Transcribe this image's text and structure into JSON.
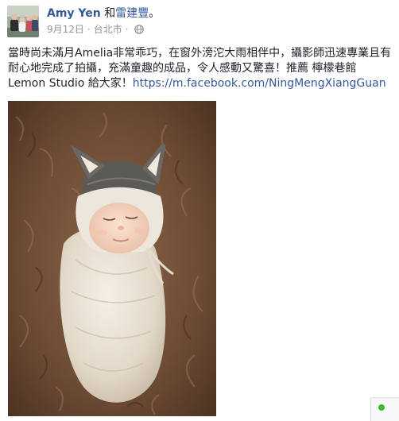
{
  "post": {
    "author": "Amy Yen",
    "with_prefix": "和",
    "with_name": "雷建豐",
    "with_suffix": "。",
    "date": "9月12日",
    "location": "台北市",
    "dot": "·",
    "privacy_icon": "globe-icon",
    "text_part1": "當時尚未滿月Amelia非常乖巧，在窗外滂沱大雨相伴中，攝影師迅速專業且有耐心地完成了拍攝，充滿童趣的成品，令人感動又驚喜！推薦 檸檬巷館 Lemon Studio 給大家！",
    "link": "https://m.facebook.com/NingMengXiangGuan"
  },
  "photo": {
    "icon": "baby-photo"
  },
  "chat": {
    "status_icon": "online-status-icon",
    "status_color": "#42b72a"
  },
  "colors": {
    "link": "#365899",
    "meta": "#90949c",
    "text": "#1d2129"
  }
}
